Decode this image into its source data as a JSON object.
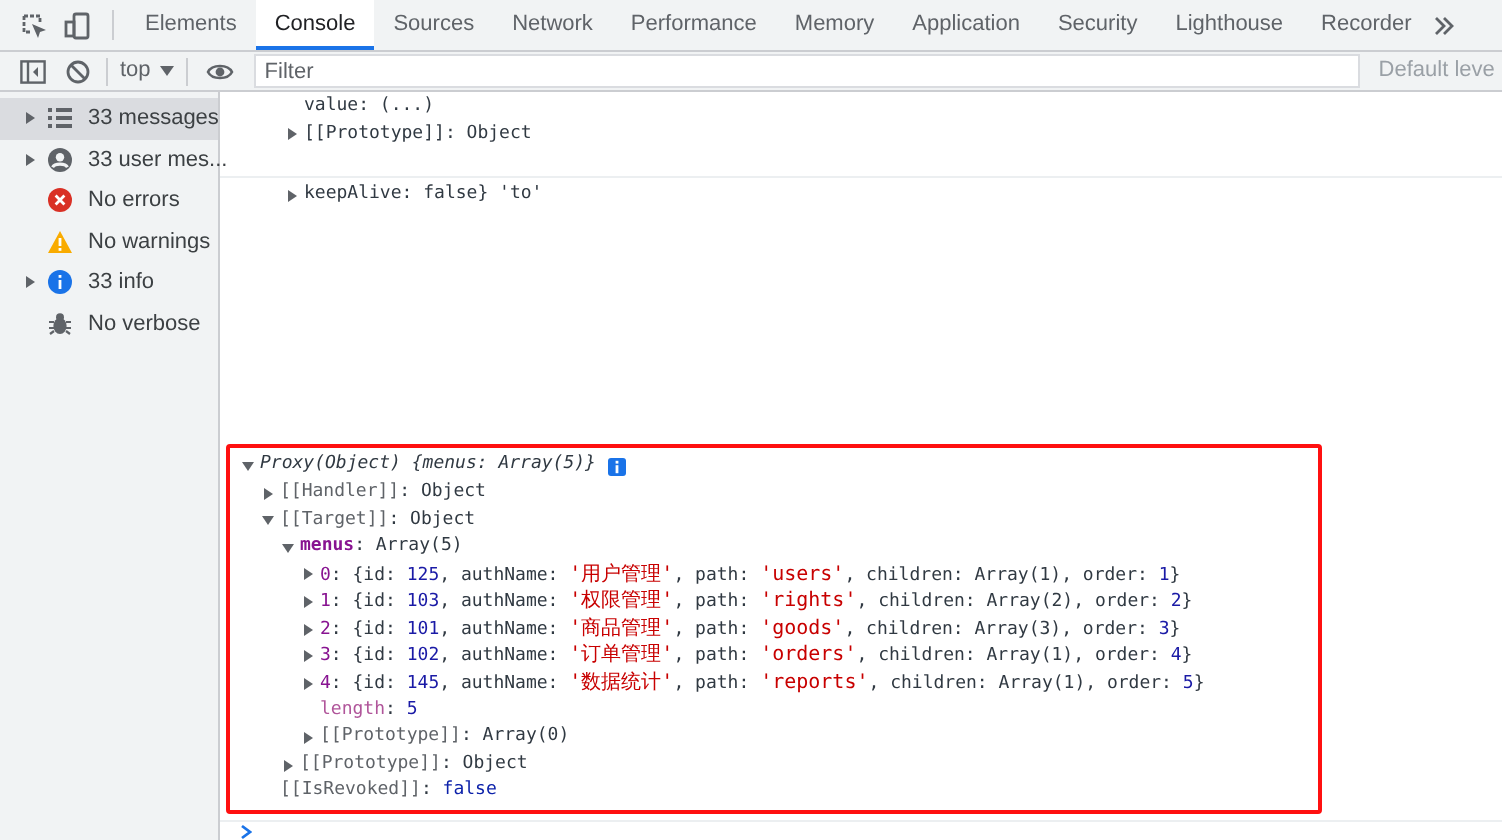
{
  "tabs": [
    {
      "label": "Elements",
      "selected": false
    },
    {
      "label": "Console",
      "selected": true
    },
    {
      "label": "Sources",
      "selected": false
    },
    {
      "label": "Network",
      "selected": false
    },
    {
      "label": "Performance",
      "selected": false
    },
    {
      "label": "Memory",
      "selected": false
    },
    {
      "label": "Application",
      "selected": false
    },
    {
      "label": "Security",
      "selected": false
    },
    {
      "label": "Lighthouse",
      "selected": false
    },
    {
      "label": "Recorder",
      "selected": false
    }
  ],
  "toolbar": {
    "context": "top",
    "filter": {
      "placeholder": "Filter"
    },
    "levels": "Default leve"
  },
  "sidebar": {
    "items": [
      {
        "kind": "messages",
        "label": "33 messages",
        "expandable": true,
        "selected": true
      },
      {
        "kind": "user",
        "label": "33 user mes...",
        "expandable": true,
        "selected": false
      },
      {
        "kind": "errors",
        "label": "No errors",
        "expandable": false,
        "selected": false
      },
      {
        "kind": "warnings",
        "label": "No warnings",
        "expandable": false,
        "selected": false
      },
      {
        "kind": "info",
        "label": "33 info",
        "expandable": true,
        "selected": false
      },
      {
        "kind": "verbose",
        "label": "No verbose",
        "expandable": false,
        "selected": false
      }
    ]
  },
  "console": {
    "partial_lines": [
      {
        "text": "value: (...)"
      },
      {
        "text": "[[Prototype]]: Object",
        "expanded": false
      },
      {
        "text": "keepAlive: false} 'to'",
        "expanded": false
      }
    ],
    "proxy": {
      "summary": "Proxy(Object) {menus: Array(5)}",
      "expanded": true,
      "children": [
        {
          "segments": [
            {
              "kind": "internal",
              "text": "[[Handler]]"
            },
            {
              "kind": "plain",
              "text": ": Object"
            }
          ],
          "expanded": false
        },
        {
          "segments": [
            {
              "kind": "internal",
              "text": "[[Target]]"
            },
            {
              "kind": "plain",
              "text": ": Object"
            }
          ],
          "expanded": true,
          "children": [
            {
              "segments": [
                {
                  "kind": "key",
                  "text": "menus"
                },
                {
                  "kind": "plain",
                  "text": ": Array(5)"
                }
              ],
              "expanded": true,
              "children": [
                {
                  "segments": [
                    {
                      "kind": "index",
                      "text": "0"
                    },
                    {
                      "kind": "plain",
                      "text": ": {id: "
                    },
                    {
                      "kind": "number",
                      "text": "125"
                    },
                    {
                      "kind": "plain",
                      "text": ", authName: "
                    },
                    {
                      "kind": "string",
                      "text": "'用户管理'"
                    },
                    {
                      "kind": "plain",
                      "text": ", path: "
                    },
                    {
                      "kind": "string",
                      "text": "'users'"
                    },
                    {
                      "kind": "plain",
                      "text": ", children: Array(1), order: "
                    },
                    {
                      "kind": "number",
                      "text": "1"
                    },
                    {
                      "kind": "plain",
                      "text": "}"
                    }
                  ],
                  "expanded": false
                },
                {
                  "segments": [
                    {
                      "kind": "index",
                      "text": "1"
                    },
                    {
                      "kind": "plain",
                      "text": ": {id: "
                    },
                    {
                      "kind": "number",
                      "text": "103"
                    },
                    {
                      "kind": "plain",
                      "text": ", authName: "
                    },
                    {
                      "kind": "string",
                      "text": "'权限管理'"
                    },
                    {
                      "kind": "plain",
                      "text": ", path: "
                    },
                    {
                      "kind": "string",
                      "text": "'rights'"
                    },
                    {
                      "kind": "plain",
                      "text": ", children: Array(2), order: "
                    },
                    {
                      "kind": "number",
                      "text": "2"
                    },
                    {
                      "kind": "plain",
                      "text": "}"
                    }
                  ],
                  "expanded": false
                },
                {
                  "segments": [
                    {
                      "kind": "index",
                      "text": "2"
                    },
                    {
                      "kind": "plain",
                      "text": ": {id: "
                    },
                    {
                      "kind": "number",
                      "text": "101"
                    },
                    {
                      "kind": "plain",
                      "text": ", authName: "
                    },
                    {
                      "kind": "string",
                      "text": "'商品管理'"
                    },
                    {
                      "kind": "plain",
                      "text": ", path: "
                    },
                    {
                      "kind": "string",
                      "text": "'goods'"
                    },
                    {
                      "kind": "plain",
                      "text": ", children: Array(3), order: "
                    },
                    {
                      "kind": "number",
                      "text": "3"
                    },
                    {
                      "kind": "plain",
                      "text": "}"
                    }
                  ],
                  "expanded": false
                },
                {
                  "segments": [
                    {
                      "kind": "index",
                      "text": "3"
                    },
                    {
                      "kind": "plain",
                      "text": ": {id: "
                    },
                    {
                      "kind": "number",
                      "text": "102"
                    },
                    {
                      "kind": "plain",
                      "text": ", authName: "
                    },
                    {
                      "kind": "string",
                      "text": "'订单管理'"
                    },
                    {
                      "kind": "plain",
                      "text": ", path: "
                    },
                    {
                      "kind": "string",
                      "text": "'orders'"
                    },
                    {
                      "kind": "plain",
                      "text": ", children: Array(1), order: "
                    },
                    {
                      "kind": "number",
                      "text": "4"
                    },
                    {
                      "kind": "plain",
                      "text": "}"
                    }
                  ],
                  "expanded": false
                },
                {
                  "segments": [
                    {
                      "kind": "index",
                      "text": "4"
                    },
                    {
                      "kind": "plain",
                      "text": ": {id: "
                    },
                    {
                      "kind": "number",
                      "text": "145"
                    },
                    {
                      "kind": "plain",
                      "text": ", authName: "
                    },
                    {
                      "kind": "string",
                      "text": "'数据统计'"
                    },
                    {
                      "kind": "plain",
                      "text": ", path: "
                    },
                    {
                      "kind": "string",
                      "text": "'reports'"
                    },
                    {
                      "kind": "plain",
                      "text": ", children: Array(1), order: "
                    },
                    {
                      "kind": "number",
                      "text": "5"
                    },
                    {
                      "kind": "plain",
                      "text": "}"
                    }
                  ],
                  "expanded": false
                },
                {
                  "segments": [
                    {
                      "kind": "key_dim",
                      "text": "length"
                    },
                    {
                      "kind": "plain",
                      "text": ": "
                    },
                    {
                      "kind": "number",
                      "text": "5"
                    }
                  ]
                },
                {
                  "segments": [
                    {
                      "kind": "internal",
                      "text": "[[Prototype]]"
                    },
                    {
                      "kind": "plain",
                      "text": ": Array(0)"
                    }
                  ],
                  "expanded": false
                }
              ]
            },
            {
              "segments": [
                {
                  "kind": "internal",
                  "text": "[[Prototype]]"
                },
                {
                  "kind": "plain",
                  "text": ": Object"
                }
              ],
              "expanded": false
            }
          ]
        },
        {
          "segments": [
            {
              "kind": "internal",
              "text": "[[IsRevoked]]"
            },
            {
              "kind": "plain",
              "text": ": "
            },
            {
              "kind": "boolean",
              "text": "false"
            }
          ]
        }
      ]
    }
  }
}
